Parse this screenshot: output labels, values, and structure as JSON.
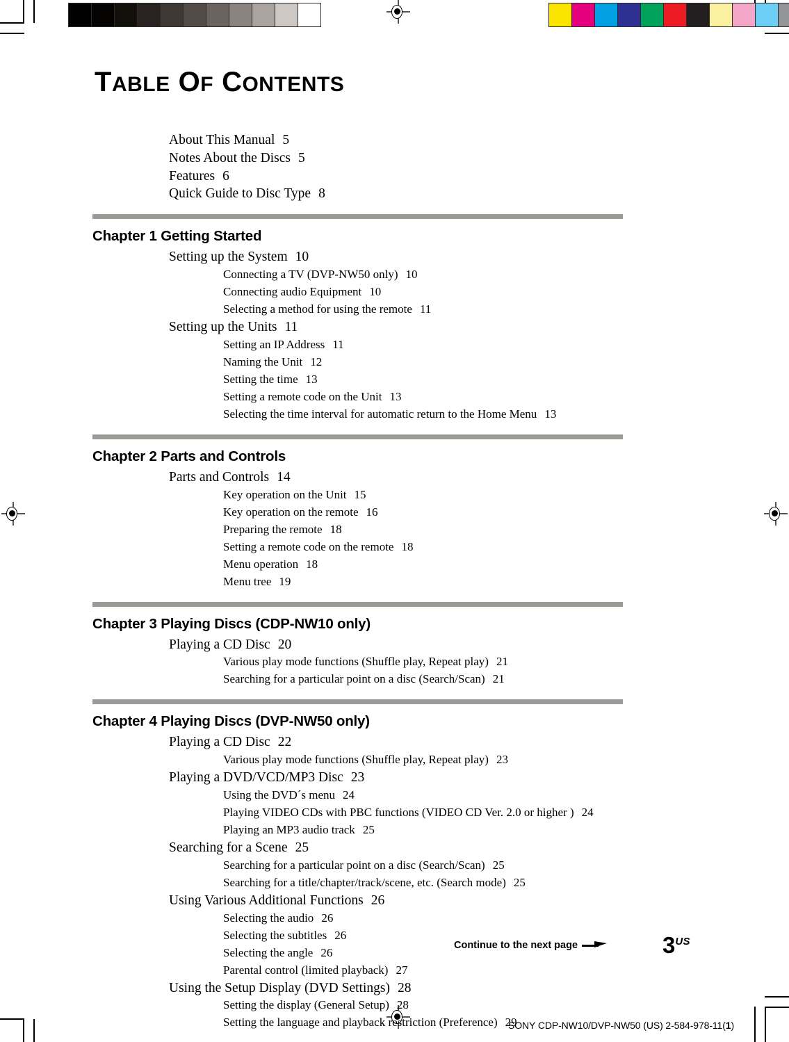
{
  "document": {
    "title_caps": "T",
    "title": "TABLE OF CONTENTS",
    "title_parts": [
      {
        "cap": "T",
        "rest": "ABLE"
      },
      {
        "cap": "O",
        "rest": "F"
      },
      {
        "cap": "C",
        "rest": "ONTENTS"
      }
    ]
  },
  "front_entries": [
    {
      "text": "About This Manual",
      "page": "5"
    },
    {
      "text": "Notes About the Discs",
      "page": "5"
    },
    {
      "text": "Features",
      "page": "6"
    },
    {
      "text": "Quick Guide to Disc Type",
      "page": "8"
    }
  ],
  "chapters": [
    {
      "heading": "Chapter 1 Getting Started",
      "entries": [
        {
          "level": 1,
          "text": "Setting up the System",
          "page": "10"
        },
        {
          "level": 2,
          "text": "Connecting a TV (DVP-NW50 only)",
          "page": "10"
        },
        {
          "level": 2,
          "text": "Connecting audio Equipment",
          "page": "10"
        },
        {
          "level": 2,
          "text": "Selecting a method for using the remote",
          "page": "11"
        },
        {
          "level": 1,
          "text": "Setting up the Units",
          "page": "11"
        },
        {
          "level": 2,
          "text": "Setting an IP Address",
          "page": "11"
        },
        {
          "level": 2,
          "text": "Naming the Unit",
          "page": "12"
        },
        {
          "level": 2,
          "text": "Setting the time",
          "page": "13"
        },
        {
          "level": 2,
          "text": "Setting a remote code on the Unit",
          "page": "13"
        },
        {
          "level": 2,
          "text": "Selecting the time interval for automatic return to the Home Menu",
          "page": "13"
        }
      ]
    },
    {
      "heading": "Chapter 2  Parts and Controls",
      "entries": [
        {
          "level": 1,
          "text": "Parts and Controls",
          "page": "14"
        },
        {
          "level": 2,
          "text": "Key operation on the Unit",
          "page": "15"
        },
        {
          "level": 2,
          "text": "Key operation on the remote",
          "page": "16"
        },
        {
          "level": 2,
          "text": "Preparing the remote",
          "page": "18"
        },
        {
          "level": 2,
          "text": "Setting a remote code on the remote",
          "page": "18"
        },
        {
          "level": 2,
          "text": "Menu operation",
          "page": "18"
        },
        {
          "level": 2,
          "text": "Menu tree",
          "page": "19"
        }
      ]
    },
    {
      "heading": "Chapter 3  Playing Discs (CDP-NW10 only)",
      "entries": [
        {
          "level": 1,
          "text": "Playing a CD Disc",
          "page": "20"
        },
        {
          "level": 2,
          "text": "Various play mode functions (Shuffle play, Repeat play)",
          "page": "21"
        },
        {
          "level": 2,
          "text": "Searching for a particular point on a disc (Search/Scan)",
          "page": "21"
        }
      ]
    },
    {
      "heading": "Chapter 4  Playing Discs (DVP-NW50 only)",
      "entries": [
        {
          "level": 1,
          "text": "Playing a CD Disc",
          "page": "22"
        },
        {
          "level": 2,
          "text": "Various play mode functions (Shuffle play, Repeat play)",
          "page": "23"
        },
        {
          "level": 1,
          "text": "Playing a DVD/VCD/MP3 Disc",
          "page": "23"
        },
        {
          "level": 2,
          "text": "Using the DVD´s menu",
          "page": "24"
        },
        {
          "level": 2,
          "text": "Playing VIDEO CDs with PBC functions (VIDEO CD Ver. 2.0 or higher )",
          "page": "24"
        },
        {
          "level": 2,
          "text": "Playing an MP3 audio track",
          "page": "25"
        },
        {
          "level": 1,
          "text": "Searching for a Scene",
          "page": "25"
        },
        {
          "level": 2,
          "text": "Searching for a particular point on a disc (Search/Scan)",
          "page": "25"
        },
        {
          "level": 2,
          "text": "Searching for a title/chapter/track/scene, etc. (Search mode)",
          "page": "25"
        },
        {
          "level": 1,
          "text": "Using Various Additional Functions",
          "page": "26"
        },
        {
          "level": 2,
          "text": "Selecting the audio",
          "page": "26"
        },
        {
          "level": 2,
          "text": "Selecting the subtitles",
          "page": "26"
        },
        {
          "level": 2,
          "text": "Selecting the angle",
          "page": "26"
        },
        {
          "level": 2,
          "text": "Parental control (limited playback)",
          "page": "27"
        },
        {
          "level": 1,
          "text": "Using the Setup Display (DVD Settings)",
          "page": "28"
        },
        {
          "level": 2,
          "text": "Setting the display (General Setup)",
          "page": "28"
        },
        {
          "level": 2,
          "text": "Setting the language and playback restriction (Preference)",
          "page": "29"
        }
      ]
    }
  ],
  "footer": {
    "continue_label": "Continue to the next page",
    "page_number": "3",
    "page_region": "US",
    "imprint_prefix": "SONY CDP-NW10/DVP-NW50 (US) 2-584-978-11(",
    "imprint_bold": "1",
    "imprint_suffix": ")"
  },
  "prepress": {
    "grayscale_patches": [
      "#000000",
      "#050301",
      "#120e09",
      "#282320",
      "#3e3834",
      "#534b47",
      "#6b6360",
      "#8b8380",
      "#aaa39f",
      "#cdc8c3",
      "#ffffff"
    ],
    "color_patches": [
      "#fbe500",
      "#e5007d",
      "#00a0e3",
      "#2e3191",
      "#00a15a",
      "#ed1c24",
      "#231f20",
      "#fbf0a0",
      "#f4a7c8",
      "#6ecff6",
      "#939598"
    ],
    "separator_color": "#9a9a96"
  }
}
